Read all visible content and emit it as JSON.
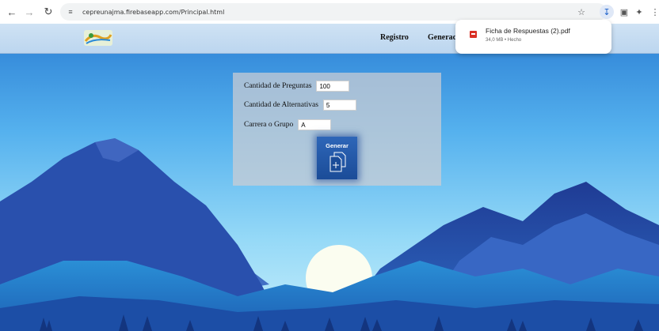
{
  "browser": {
    "url": "cepreunajma.firebaseapp.com/Principal.html"
  },
  "site": {
    "nav": {
      "registro": "Registro",
      "generar": "Generac"
    }
  },
  "form": {
    "fields": [
      {
        "label": "Cantidad de Preguntas",
        "value": "100"
      },
      {
        "label": "Cantidad de Alternativas",
        "value": "5"
      },
      {
        "label": "Carrera o Grupo",
        "value": "A"
      }
    ],
    "button_label": "Generar"
  },
  "download": {
    "filename": "Ficha de Respuestas (2).pdf",
    "status": "34,0 MB • Hecho"
  },
  "colors": {
    "accent_download": "#1a5fc9",
    "pdf_red": "#d93025",
    "button_blue": "#2e66b8"
  }
}
